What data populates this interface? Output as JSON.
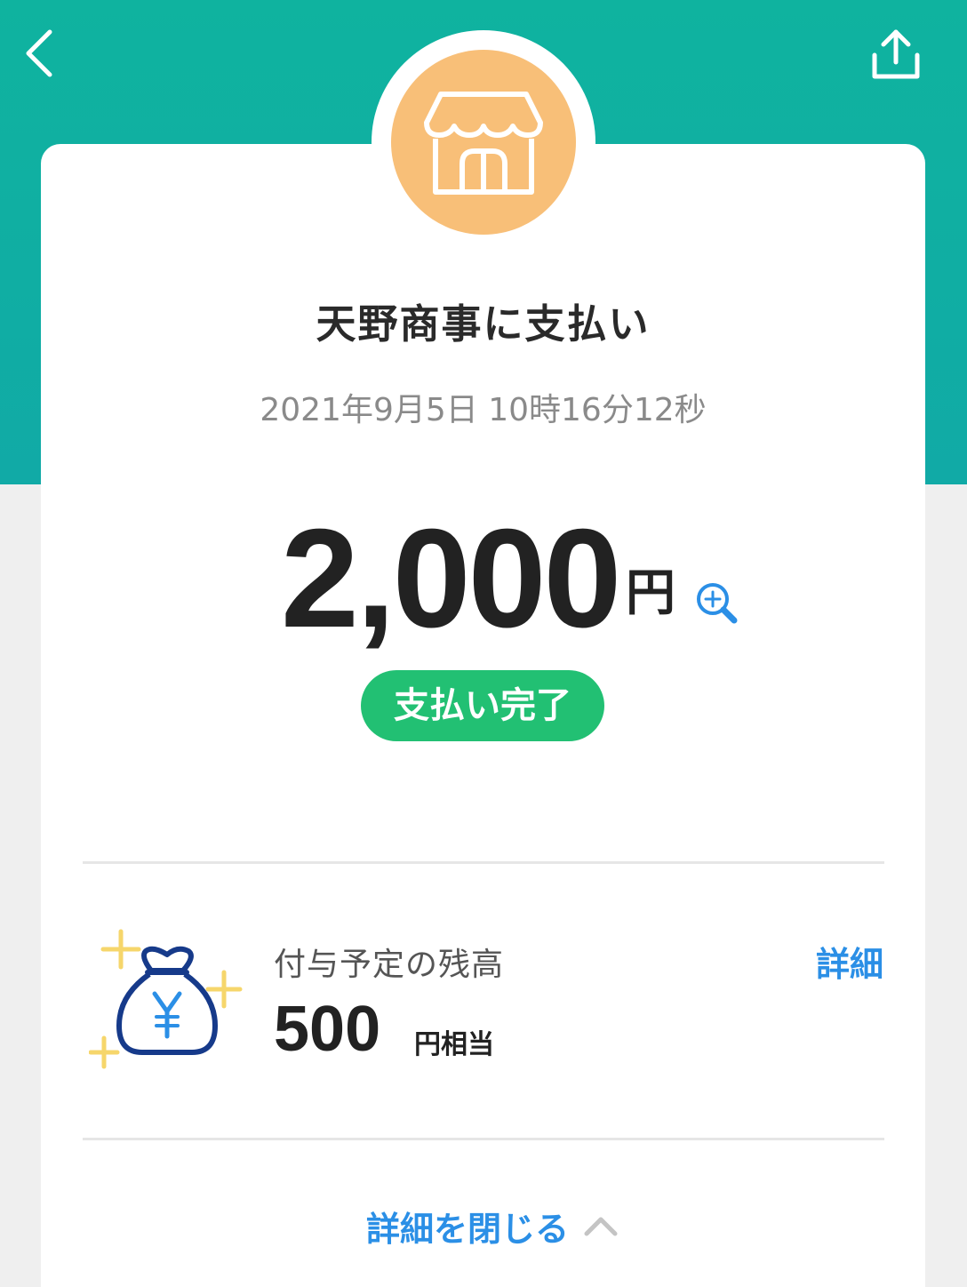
{
  "header": {
    "back_icon": "chevron-left-icon",
    "share_icon": "share-icon"
  },
  "merchant": {
    "icon": "store-icon",
    "title": "天野商事に支払い",
    "datetime": "2021年9月5日 10時16分12秒"
  },
  "payment": {
    "amount": "2,000",
    "currency": "円",
    "status": "支払い完了",
    "zoom_icon": "zoom-in-icon"
  },
  "points": {
    "icon": "money-bag-icon",
    "label": "付与予定の残高",
    "value": "500",
    "unit": "円相当",
    "details_link": "詳細"
  },
  "footer": {
    "close_details": "詳細を閉じる"
  },
  "colors": {
    "header": "#0fb39f",
    "store_circle": "#f8bf78",
    "status_green": "#22c073",
    "link_blue": "#2b8fe6",
    "bag_navy": "#163a8a",
    "sparkle_yellow": "#f6d66b"
  }
}
